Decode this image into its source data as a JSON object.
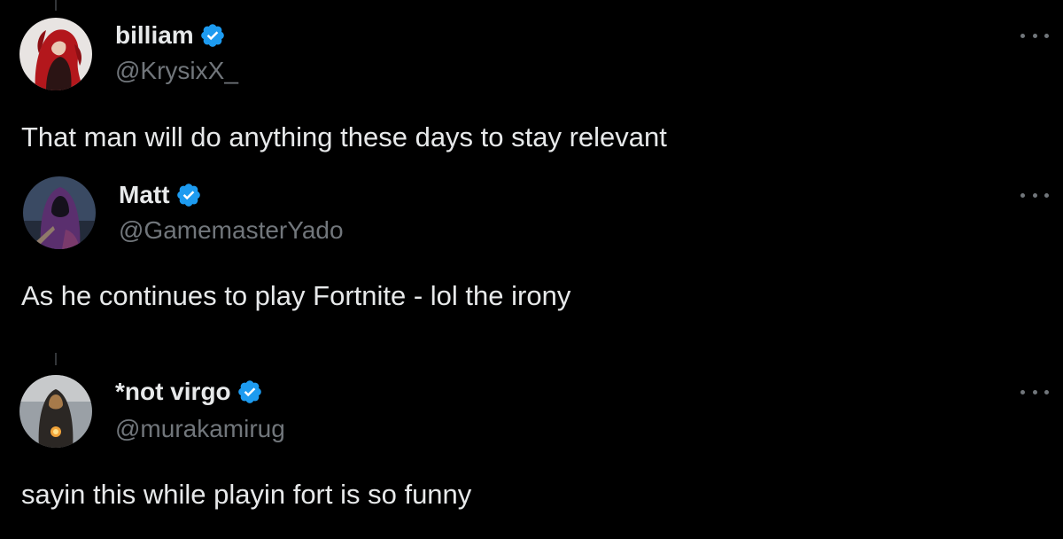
{
  "colors": {
    "background": "#000000",
    "text": "#e7e9ea",
    "muted": "#71767b",
    "verified": "#1d9bf0"
  },
  "posts": [
    {
      "name": "billiam",
      "handle": "@KrysixX_",
      "text": "That man will do anything these days to stay relevant",
      "verified": true,
      "avatar_icon": "avatar-red-haired-character"
    },
    {
      "name": "Matt",
      "handle": "@GamemasterYado",
      "text": "As he continues to play Fortnite - lol the irony",
      "verified": true,
      "avatar_icon": "avatar-hooded-figure"
    },
    {
      "name": "*not virgo",
      "handle": "@murakamirug",
      "text": "sayin this while playin fort is so funny",
      "verified": true,
      "avatar_icon": "avatar-hooded-lantern-figure"
    }
  ],
  "icons": {
    "verified": "verified-badge-icon",
    "more": "more-options-icon"
  }
}
